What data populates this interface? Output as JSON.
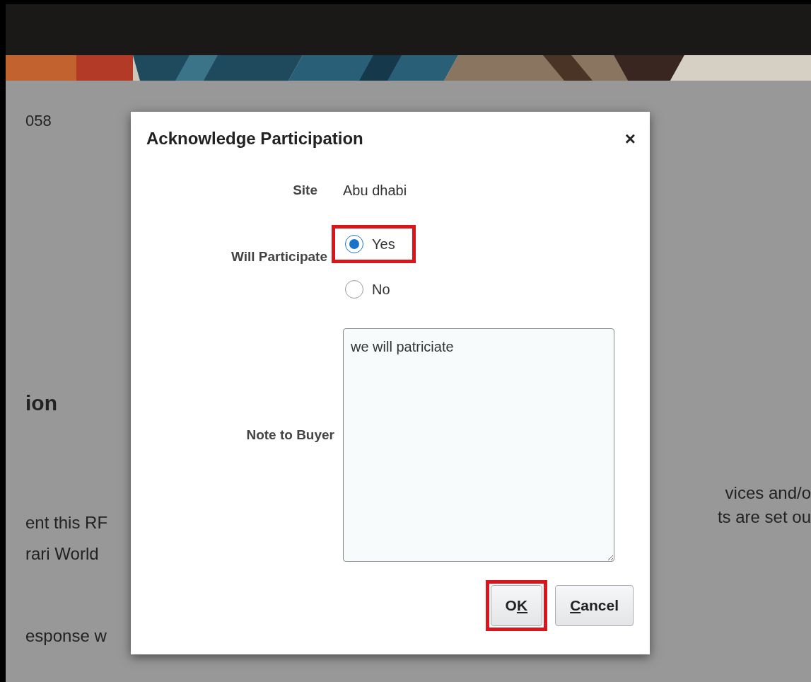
{
  "page": {
    "fragments_left": [
      {
        "text": "058",
        "kind": "plain"
      },
      {
        "text": "ion",
        "kind": "heading"
      },
      {
        "text": "ent this RF",
        "kind": "plain"
      },
      {
        "text": "rari World",
        "kind": "plain"
      },
      {
        "text": "esponse w",
        "kind": "plain"
      }
    ],
    "fragments_right": [
      {
        "text": "vices and/o"
      },
      {
        "text": "ts are set ou"
      }
    ]
  },
  "dialog": {
    "title": "Acknowledge Participation",
    "close": "×",
    "site": {
      "label": "Site",
      "value": "Abu dhabi"
    },
    "participate": {
      "label": "Will Participate",
      "options": [
        {
          "label": "Yes",
          "selected": true,
          "highlighted": true
        },
        {
          "label": "No",
          "selected": false,
          "highlighted": false
        }
      ]
    },
    "note": {
      "label": "Note to Buyer",
      "value": "we will patriciate"
    },
    "buttons": [
      {
        "label_parts": [
          {
            "text": "O",
            "underlined": false
          },
          {
            "text": "K",
            "underlined": true
          }
        ],
        "highlighted": true
      },
      {
        "label_parts": [
          {
            "text": "C",
            "underlined": true
          },
          {
            "text": "ancel",
            "underlined": false
          }
        ],
        "highlighted": false
      }
    ]
  }
}
